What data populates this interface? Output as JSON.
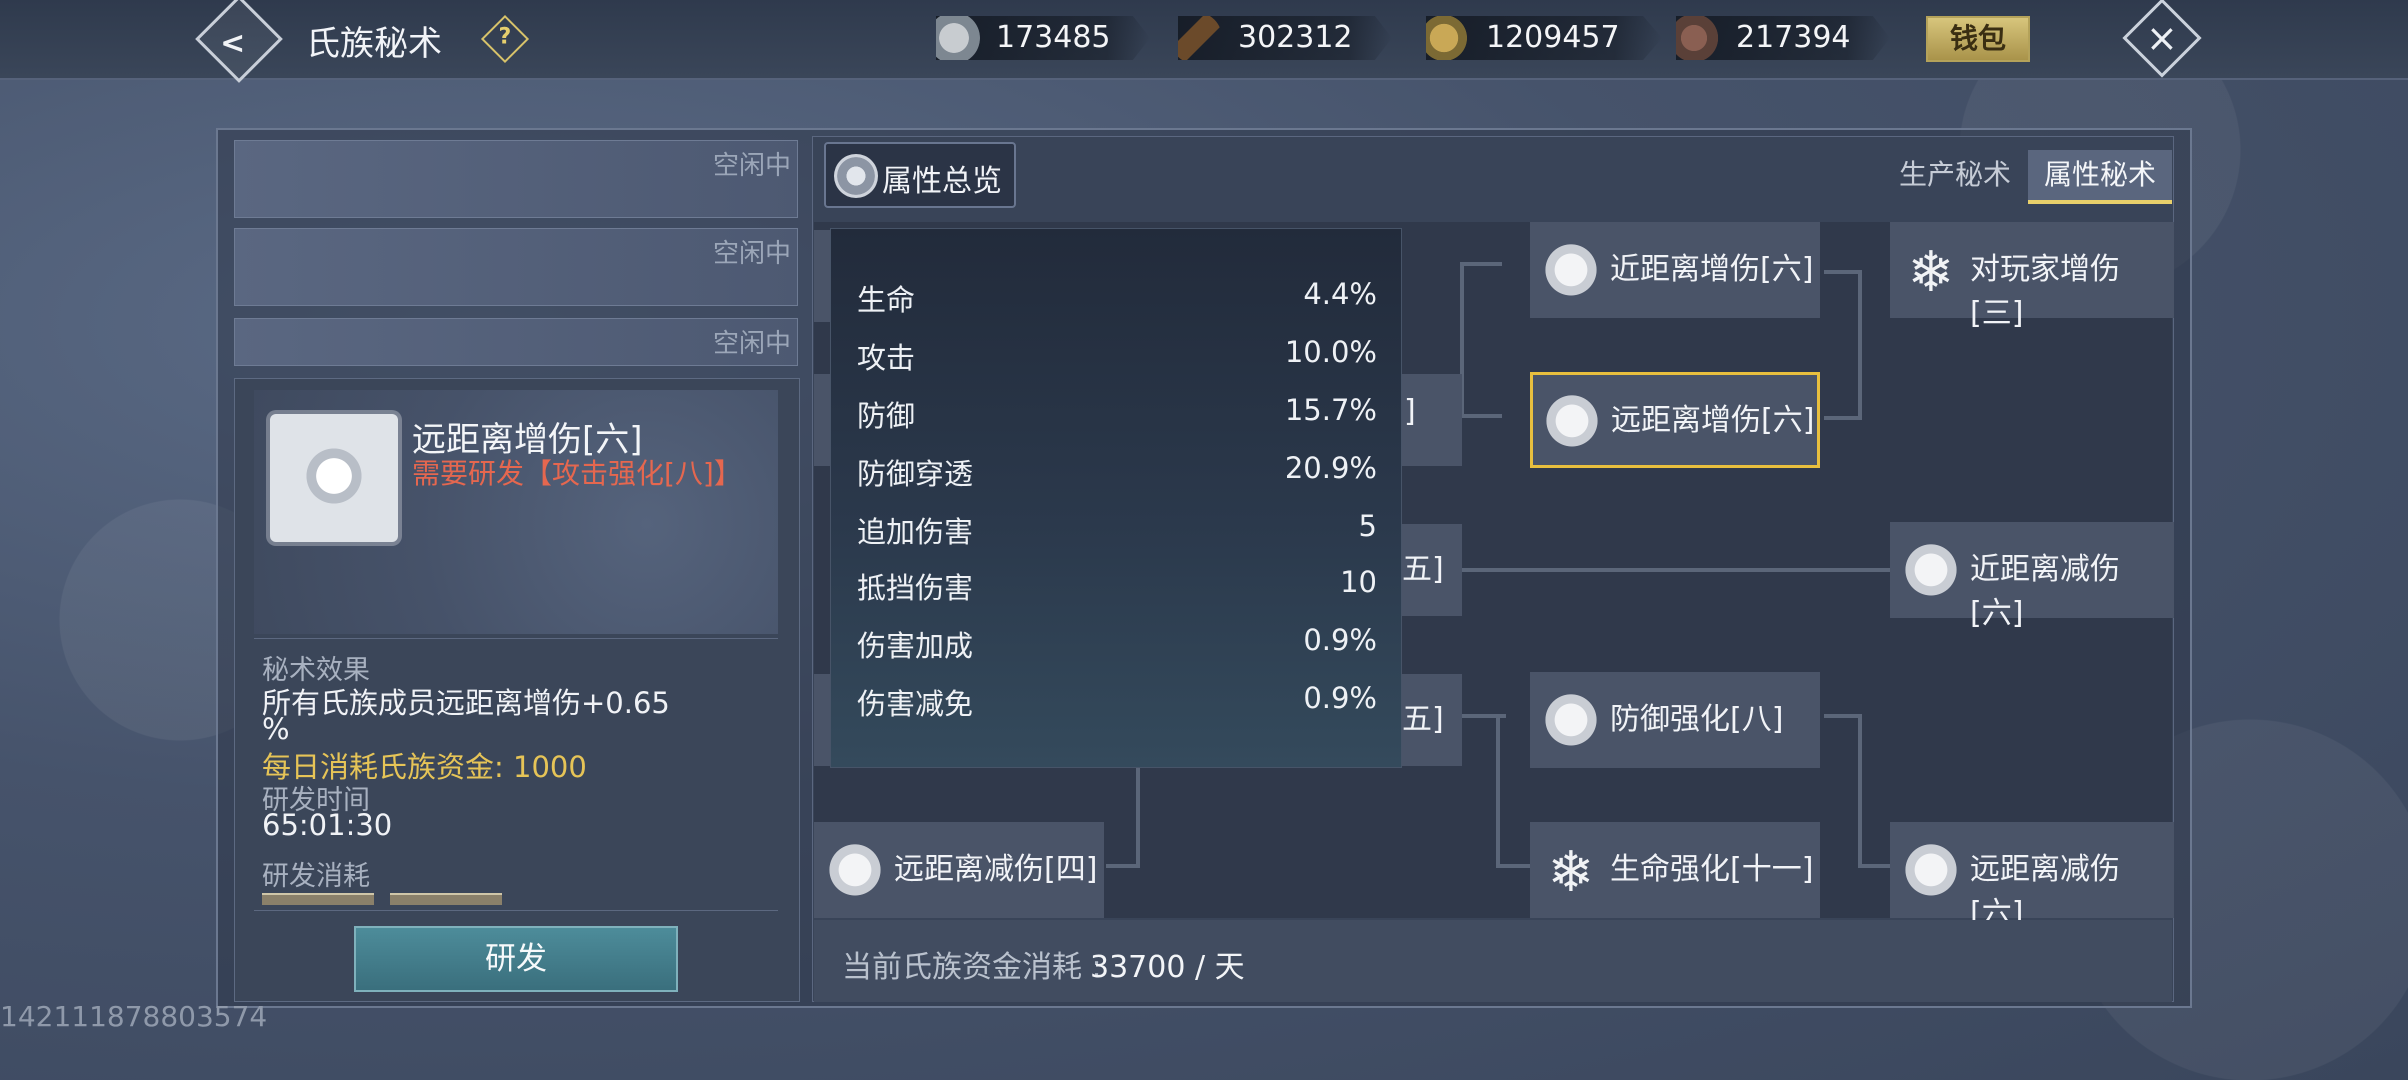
{
  "header": {
    "title": "氏族秘术",
    "help": "?",
    "wallet_label": "钱包",
    "resources": [
      {
        "icon": "coin-icon",
        "value": "173485"
      },
      {
        "icon": "wood-icon",
        "value": "302312"
      },
      {
        "icon": "food-icon",
        "value": "1209457"
      },
      {
        "icon": "ore-icon",
        "value": "217394"
      }
    ]
  },
  "queue": [
    {
      "status": "空闲中"
    },
    {
      "status": "空闲中"
    },
    {
      "status": "空闲中"
    }
  ],
  "detail": {
    "name": "远距离增伤[六]",
    "requirement": "需要研发【攻击强化[八]】",
    "effect_label": "秘术效果",
    "effect_text_1": "所有氏族成员远距离增伤+0.65",
    "effect_text_2": "%",
    "daily_cost": "每日消耗氏族资金: 1000",
    "time_label": "研发时间",
    "time_value": "65:01:30",
    "consume_label": "研发消耗",
    "research_button": "研发"
  },
  "player_id": "142111878803574",
  "overview": {
    "button_label": "属性总览",
    "stats": [
      {
        "name": "生命",
        "value": "4.4%"
      },
      {
        "name": "攻击",
        "value": "10.0%"
      },
      {
        "name": "防御",
        "value": "15.7%"
      },
      {
        "name": "防御穿透",
        "value": "20.9%"
      },
      {
        "name": "追加伤害",
        "value": "5"
      },
      {
        "name": "抵挡伤害",
        "value": "10"
      },
      {
        "name": "伤害加成",
        "value": "0.9%"
      },
      {
        "name": "伤害减免",
        "value": "0.9%"
      }
    ]
  },
  "tabs": [
    {
      "label": "生产秘术",
      "active": false
    },
    {
      "label": "属性秘术",
      "active": true
    }
  ],
  "tree": {
    "nodes": {
      "n1": {
        "label": "近距离增伤[六]"
      },
      "n2": {
        "label": "对玩家增伤[三]"
      },
      "n3": {
        "label": "远距离增伤[六]"
      },
      "n4": {
        "label": "近距离减伤[六]"
      },
      "n5": {
        "label": "防御强化[八]"
      },
      "n6": {
        "label": "远距离减伤[四]"
      },
      "n7": {
        "label": "生命强化[十一]"
      },
      "n8": {
        "label": "远距离减伤[六]"
      }
    },
    "partials": {
      "p1": "]",
      "p2": "五]",
      "p3": "五]"
    }
  },
  "footer": {
    "label": "当前氏族资金消耗 :",
    "value": "33700 / 天"
  },
  "colors": {
    "selected_border": "#e8bf3e",
    "warning_text": "#e5674f",
    "cost_text": "#e6c457",
    "tab_indicator": "#e8d06b"
  }
}
